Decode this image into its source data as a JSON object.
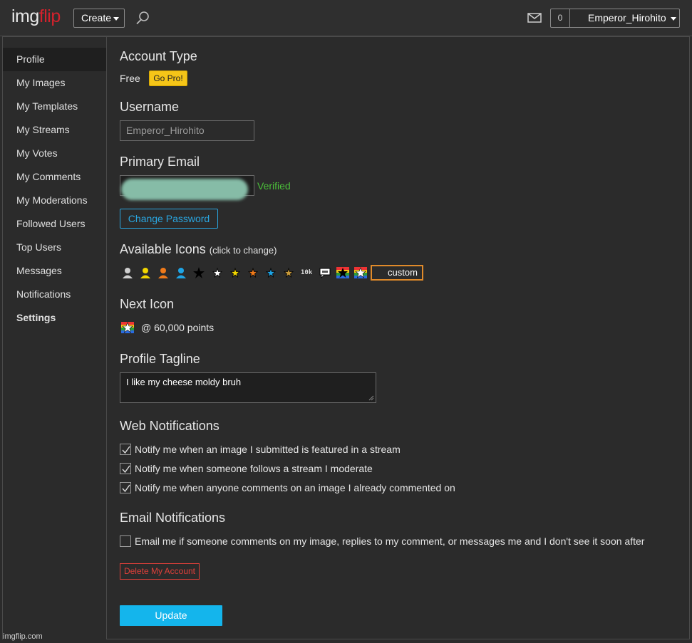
{
  "header": {
    "logo_img": "img",
    "logo_flip": "flip",
    "create_label": "Create",
    "notif_count": "0",
    "username": "Emperor_Hirohito"
  },
  "sidebar": {
    "items": [
      {
        "label": "Profile"
      },
      {
        "label": "My Images"
      },
      {
        "label": "My Templates"
      },
      {
        "label": "My Streams"
      },
      {
        "label": "My Votes"
      },
      {
        "label": "My Comments"
      },
      {
        "label": "My Moderations"
      },
      {
        "label": "Followed Users"
      },
      {
        "label": "Top Users"
      },
      {
        "label": "Messages"
      },
      {
        "label": "Notifications"
      },
      {
        "label": "Settings"
      }
    ]
  },
  "account": {
    "heading": "Account Type",
    "type": "Free",
    "gopro_label": "Go Pro!"
  },
  "username_section": {
    "heading": "Username",
    "value": "Emperor_Hirohito"
  },
  "email_section": {
    "heading": "Primary Email",
    "status": "Verified",
    "change_password_label": "Change Password"
  },
  "icons_section": {
    "heading": "Available Icons",
    "hint": "(click to change)",
    "tenk_label": "10k",
    "custom_label": "custom"
  },
  "next_icon": {
    "heading": "Next Icon",
    "points": "@ 60,000 points"
  },
  "tagline_section": {
    "heading": "Profile Tagline",
    "value": "I like my cheese moldy bruh"
  },
  "web_notifications": {
    "heading": "Web Notifications",
    "options": [
      {
        "label": "Notify me when an image I submitted is featured in a stream",
        "checked": true
      },
      {
        "label": "Notify me when someone follows a stream I moderate",
        "checked": true
      },
      {
        "label": "Notify me when anyone comments on an image I already commented on",
        "checked": true
      }
    ]
  },
  "email_notifications": {
    "heading": "Email Notifications",
    "options": [
      {
        "label": "Email me if someone comments on my image, replies to my comment, or messages me and I don't see it soon after",
        "checked": false
      }
    ]
  },
  "actions": {
    "delete_label": "Delete My Account",
    "update_label": "Update"
  },
  "footer": {
    "watermark": "imgflip.com"
  },
  "colors": {
    "background": "#2b2b2b",
    "brand_red": "#d3212c",
    "link_blue": "#2aa6e0",
    "update_blue": "#14b5ec",
    "verified_green": "#4bbf3a",
    "danger_red": "#e0403a",
    "gopro_yellow": "#f5c518",
    "custom_orange": "#e08a2a"
  }
}
